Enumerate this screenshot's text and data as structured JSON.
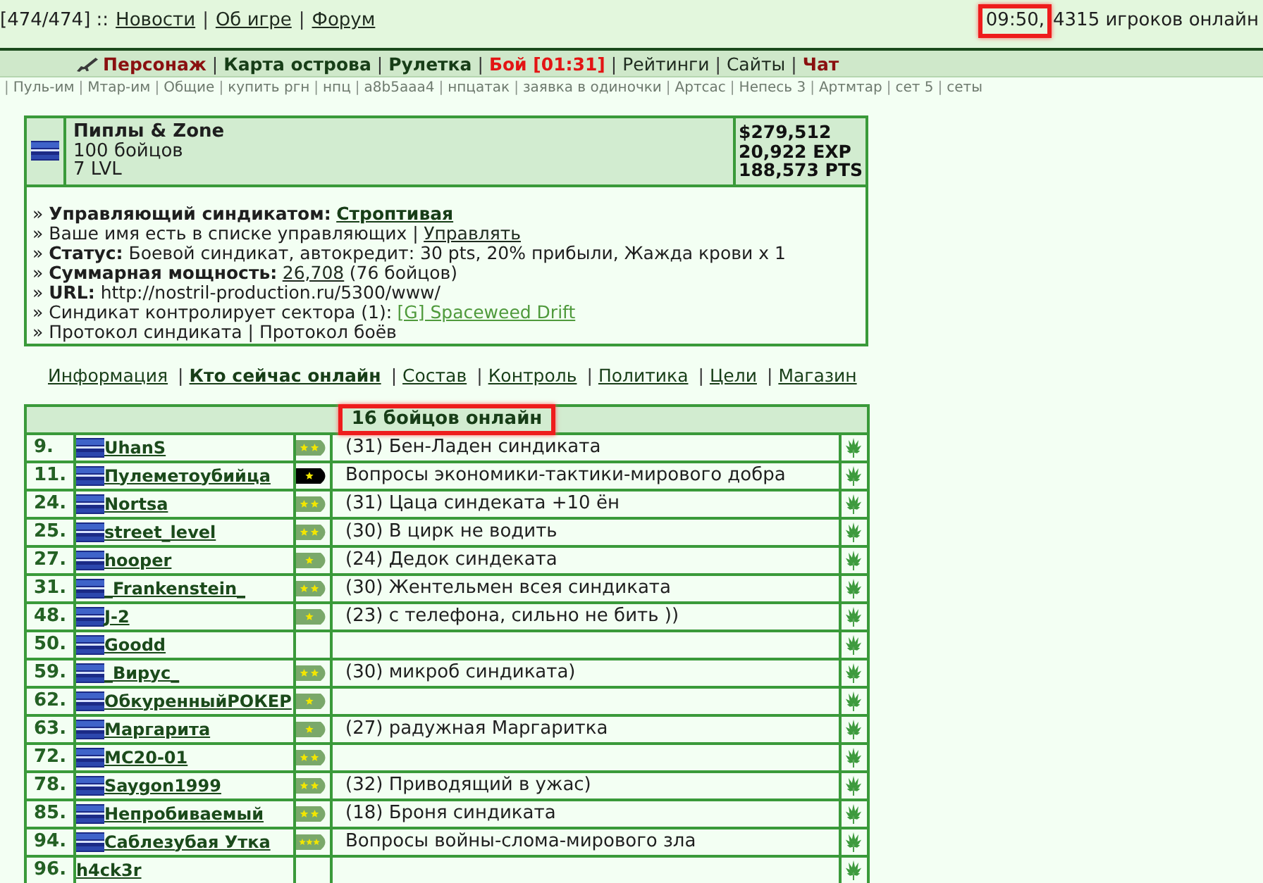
{
  "top_bar": {
    "counter": "[474/474] ::",
    "links": [
      "Новости",
      "Об игре",
      "Форум"
    ],
    "separator": "|",
    "clock": {
      "text": "09:50,",
      "highlighted": true
    },
    "online": "4315 игроков онлайн"
  },
  "main_nav": {
    "separator": "|",
    "items": [
      {
        "label": "Персонаж",
        "kind": "character"
      },
      {
        "label": "Карта острова",
        "kind": "bold"
      },
      {
        "label": "Рулетка",
        "kind": "bold"
      },
      {
        "label": "Бой [01:31]",
        "kind": "alert"
      },
      {
        "label": "Рейтинги",
        "kind": "plain"
      },
      {
        "label": "Сайты",
        "kind": "plain"
      },
      {
        "label": "Чат",
        "kind": "accent"
      }
    ]
  },
  "quick_links": {
    "separator": "|",
    "items": [
      "Пуль-им",
      "Мтар-им",
      "Общие",
      "купить ргн",
      "нпц",
      "a8b5aaa4",
      "нпцатак",
      "заявка в одиночки",
      "Артсас",
      "Непесь 3",
      "Артмтар",
      "сет 5",
      "сеты"
    ]
  },
  "syndicate": {
    "name": "Пиплы & Zone",
    "members": "100 бойцов",
    "level": "7 LVL",
    "money": "$279,512",
    "exp": "20,922 EXP",
    "pts": "188,573 PTS",
    "lines": [
      {
        "text": "» **Управляющий синдикатом:**",
        "link": {
          "text": "Строптивая",
          "kind": "bold"
        }
      },
      {
        "text": "» Ваше имя есть в списке управляющих |",
        "link": {
          "text": "Управлять",
          "kind": "plain"
        }
      },
      {
        "text": "» **Статус:** Боевой синдикат, автокредит: 30 pts, 20% прибыли, Жажда крови x 1"
      },
      {
        "text": "» **Суммарная мощность:**",
        "link": {
          "text": "26,708",
          "kind": "plain"
        },
        "after": "(76 бойцов)"
      },
      {
        "text": "» **URL:** http://nostril-production.ru/5300/www/"
      },
      {
        "text": "» Синдикат контролирует сектора (1):",
        "link": {
          "text": "[G] Spaceweed Drift",
          "kind": "sector"
        }
      },
      {
        "text": "» Протокол синдиката | Протокол боёв"
      }
    ]
  },
  "tabs": {
    "separator": "|",
    "items": [
      {
        "label": "Информация",
        "selected": false
      },
      {
        "label": "Кто сейчас онлайн",
        "selected": true
      },
      {
        "label": "Состав",
        "selected": false
      },
      {
        "label": "Контроль",
        "selected": false
      },
      {
        "label": "Политика",
        "selected": false
      },
      {
        "label": "Цели",
        "selected": false
      },
      {
        "label": "Магазин",
        "selected": false
      }
    ]
  },
  "online_table": {
    "title": {
      "text": "16 бойцов онлайн",
      "highlighted": true
    },
    "rows": [
      {
        "rank": "9.",
        "name": "UhanS",
        "flag": true,
        "badge": {
          "kind": "double",
          "color": "#7aa86a"
        },
        "note": "(31) Бен-Ладен синдиката"
      },
      {
        "rank": "11.",
        "name": "Пулеметоубийца",
        "flag": true,
        "badge": {
          "kind": "single",
          "color": "#000000"
        },
        "note": "Вопросы экономики-тактики-мирового добра"
      },
      {
        "rank": "24.",
        "name": "Nortsa",
        "flag": true,
        "badge": {
          "kind": "double",
          "color": "#7aa86a"
        },
        "note": "(31) Цаца синдеката +10 ён"
      },
      {
        "rank": "25.",
        "name": "street_level",
        "flag": true,
        "badge": {
          "kind": "double",
          "color": "#7aa86a"
        },
        "note": "(30) В цирк не водить"
      },
      {
        "rank": "27.",
        "name": "hooper",
        "flag": true,
        "badge": {
          "kind": "single",
          "color": "#7aa86a"
        },
        "note": "(24) Дедок синдеката"
      },
      {
        "rank": "31.",
        "name": "_Frankenstein_",
        "flag": true,
        "badge": {
          "kind": "double",
          "color": "#7aa86a"
        },
        "note": "(30) Жентельмен всея синдиката"
      },
      {
        "rank": "48.",
        "name": "J-2",
        "flag": true,
        "badge": {
          "kind": "single",
          "color": "#7aa86a"
        },
        "note": "(23) с телефона, сильно не бить ))"
      },
      {
        "rank": "50.",
        "name": "Goodd",
        "flag": true
      },
      {
        "rank": "59.",
        "name": "_Вирус_",
        "flag": true,
        "badge": {
          "kind": "double",
          "color": "#7aa86a"
        },
        "note": "(30) микроб синдиката)"
      },
      {
        "rank": "62.",
        "name": "ОбкуренныйРОКЕР",
        "flag": true,
        "badge": {
          "kind": "single",
          "color": "#7aa86a"
        }
      },
      {
        "rank": "63.",
        "name": "Маргарита",
        "flag": true,
        "badge": {
          "kind": "single",
          "color": "#7aa86a"
        },
        "note": "(27) радужная Маргаритка"
      },
      {
        "rank": "72.",
        "name": "MC20-01",
        "flag": true,
        "badge": {
          "kind": "double",
          "color": "#7aa86a"
        }
      },
      {
        "rank": "78.",
        "name": "Saygon1999",
        "flag": true,
        "badge": {
          "kind": "double",
          "color": "#7aa86a"
        },
        "note": "(32) Приводящий в ужас)"
      },
      {
        "rank": "85.",
        "name": "Непробиваемый",
        "flag": true,
        "badge": {
          "kind": "double",
          "color": "#7aa86a"
        },
        "note": "(18) Броня синдиката"
      },
      {
        "rank": "94.",
        "name": "Саблезубая Утка",
        "flag": true,
        "badge": {
          "kind": "triple",
          "color": "#7aa86a"
        },
        "note": "Вопросы войны-слома-мирового зла"
      },
      {
        "rank": "96.",
        "name": "h4ck3r",
        "flag": false
      }
    ]
  }
}
